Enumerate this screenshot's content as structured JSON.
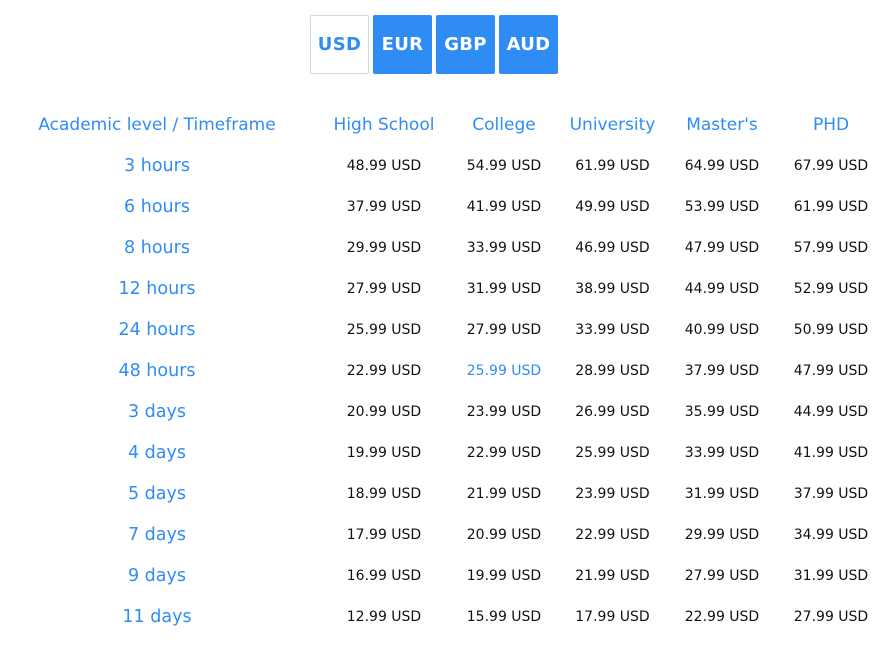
{
  "currencies": [
    {
      "label": "USD",
      "active": true
    },
    {
      "label": "EUR",
      "active": false
    },
    {
      "label": "GBP",
      "active": false
    },
    {
      "label": "AUD",
      "active": false
    }
  ],
  "table": {
    "corner_header": "Academic level / Timeframe",
    "columns": [
      "High School",
      "College",
      "University",
      "Master's",
      "PHD"
    ],
    "rows": [
      {
        "timeframe": "3 hours",
        "prices": [
          "48.99 USD",
          "54.99 USD",
          "61.99 USD",
          "64.99 USD",
          "67.99 USD"
        ]
      },
      {
        "timeframe": "6 hours",
        "prices": [
          "37.99 USD",
          "41.99 USD",
          "49.99 USD",
          "53.99 USD",
          "61.99 USD"
        ]
      },
      {
        "timeframe": "8 hours",
        "prices": [
          "29.99 USD",
          "33.99 USD",
          "46.99 USD",
          "47.99 USD",
          "57.99 USD"
        ]
      },
      {
        "timeframe": "12 hours",
        "prices": [
          "27.99 USD",
          "31.99 USD",
          "38.99 USD",
          "44.99 USD",
          "52.99 USD"
        ]
      },
      {
        "timeframe": "24 hours",
        "prices": [
          "25.99 USD",
          "27.99 USD",
          "33.99 USD",
          "40.99 USD",
          "50.99 USD"
        ]
      },
      {
        "timeframe": "48 hours",
        "prices": [
          "22.99 USD",
          "25.99 USD",
          "28.99 USD",
          "37.99 USD",
          "47.99 USD"
        ]
      },
      {
        "timeframe": "3 days",
        "prices": [
          "20.99 USD",
          "23.99 USD",
          "26.99 USD",
          "35.99 USD",
          "44.99 USD"
        ]
      },
      {
        "timeframe": "4 days",
        "prices": [
          "19.99 USD",
          "22.99 USD",
          "25.99 USD",
          "33.99 USD",
          "41.99 USD"
        ]
      },
      {
        "timeframe": "5 days",
        "prices": [
          "18.99 USD",
          "21.99 USD",
          "23.99 USD",
          "31.99 USD",
          "37.99 USD"
        ]
      },
      {
        "timeframe": "7 days",
        "prices": [
          "17.99 USD",
          "20.99 USD",
          "22.99 USD",
          "29.99 USD",
          "34.99 USD"
        ]
      },
      {
        "timeframe": "9 days",
        "prices": [
          "16.99 USD",
          "19.99 USD",
          "21.99 USD",
          "27.99 USD",
          "31.99 USD"
        ]
      },
      {
        "timeframe": "11 days",
        "prices": [
          "12.99 USD",
          "15.99 USD",
          "17.99 USD",
          "22.99 USD",
          "27.99 USD"
        ]
      }
    ],
    "highlighted_cell": {
      "row": 5,
      "col": 1
    }
  },
  "colors": {
    "accent": "#2f8cf5",
    "text": "#111111",
    "active_border": "#cfd8e3"
  }
}
